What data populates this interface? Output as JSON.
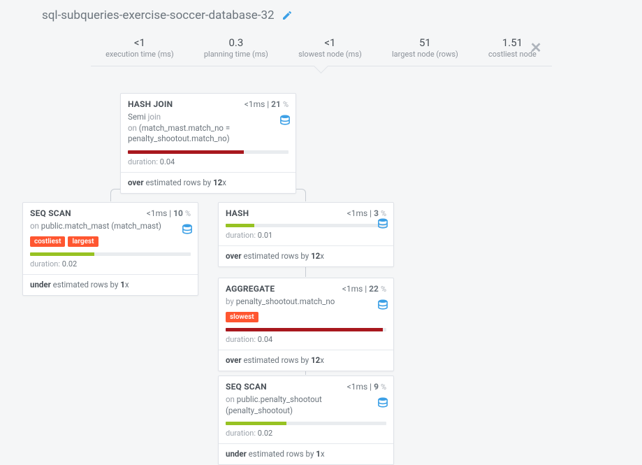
{
  "title": "sql-subqueries-exercise-soccer-database-32",
  "stats": {
    "exec_time_value": "<1",
    "exec_time_label": "execution time (ms)",
    "planning_time_value": "0.3",
    "planning_time_label": "planning time (ms)",
    "slowest_node_value": "<1",
    "slowest_node_label": "slowest node (ms)",
    "largest_node_value": "51",
    "largest_node_label": "largest node (rows)",
    "costliest_node_value": "1.51",
    "costliest_node_label": "costliest node"
  },
  "nodes": {
    "hashjoin": {
      "title": "HASH JOIN",
      "ms": "<1ms",
      "pct": "21",
      "sub_prefix": "Semi",
      "sub_kw1": "join",
      "sub_kw2": "on",
      "sub_suffix": "(match_mast.match_no = penalty_shootout.match_no)",
      "barWidth": "72%",
      "barClass": "bar-red",
      "durationLabel": "duration:",
      "durationVal": "0.04",
      "estimate_kw": "over",
      "estimate_mid": "estimated rows by",
      "estimate_factor": "12"
    },
    "seqscan_left": {
      "title": "SEQ SCAN",
      "ms": "<1ms",
      "pct": "10",
      "sub_kw": "on",
      "sub_text": "public.match_mast (match_mast)",
      "tag1": "costliest",
      "tag2": "largest",
      "barWidth": "40%",
      "barClass": "bar-green",
      "durationLabel": "duration:",
      "durationVal": "0.02",
      "estimate_kw": "under",
      "estimate_mid": "estimated rows by",
      "estimate_factor": "1"
    },
    "hash": {
      "title": "HASH",
      "ms": "<1ms",
      "pct": "3",
      "barWidth": "18%",
      "barClass": "bar-green",
      "durationLabel": "duration:",
      "durationVal": "0.01",
      "estimate_kw": "over",
      "estimate_mid": "estimated rows by",
      "estimate_factor": "12"
    },
    "aggregate": {
      "title": "AGGREGATE",
      "ms": "<1ms",
      "pct": "22",
      "sub_kw": "by",
      "sub_text": "penalty_shootout.match_no",
      "tag1": "slowest",
      "barWidth": "98%",
      "barClass": "bar-red",
      "durationLabel": "duration:",
      "durationVal": "0.04",
      "estimate_kw": "over",
      "estimate_mid": "estimated rows by",
      "estimate_factor": "12"
    },
    "seqscan_bottom": {
      "title": "SEQ SCAN",
      "ms": "<1ms",
      "pct": "9",
      "sub_kw": "on",
      "sub_text": "public.penalty_shootout (penalty_shootout)",
      "barWidth": "38%",
      "barClass": "bar-green",
      "durationLabel": "duration:",
      "durationVal": "0.02",
      "estimate_kw": "under",
      "estimate_mid": "estimated rows by",
      "estimate_factor": "1"
    }
  }
}
